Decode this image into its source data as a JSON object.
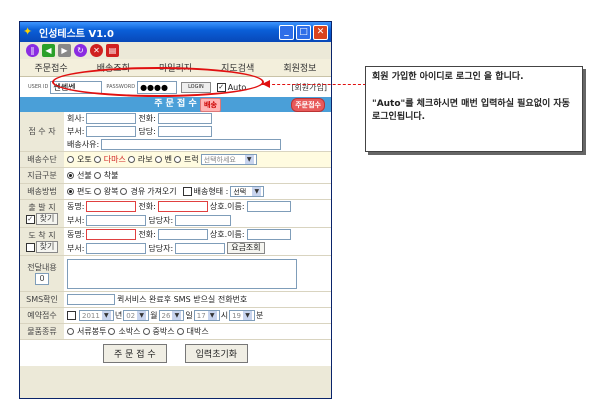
{
  "window": {
    "title": "인성테스트 V1.0"
  },
  "tabs": [
    "주문접수",
    "배송조회",
    "마일리지",
    "지도검색",
    "회원정보"
  ],
  "login": {
    "user_label": "USER ID",
    "user_value": "쎈쎈쎈",
    "pw_label": "PASSWORD",
    "pw_value": "●●●●",
    "login_btn": "LOGIN",
    "auto_label": "Auto",
    "register": "[회원가입]"
  },
  "banner": {
    "title": "주 문 접 수",
    "badge1": "배송",
    "badge2": "주문접수"
  },
  "receiver": {
    "label": "접 수 자",
    "company": "회사:",
    "phone": "전화:",
    "dept": "부서:",
    "manager": "담당:",
    "reason": "배송사유:"
  },
  "delivery_means": {
    "label": "배송수단",
    "options": [
      "오토",
      "다마스",
      "라보",
      "벤",
      "트럭"
    ],
    "select": "선택하세요"
  },
  "payment": {
    "label": "지급구분",
    "options": [
      "선불",
      "착불"
    ]
  },
  "method": {
    "label": "배송방법",
    "options": [
      "편도",
      "왕복",
      "경유",
      "가져오기"
    ],
    "type_label": "배송형태 :",
    "type_select": "선택"
  },
  "departure": {
    "label": "출 발 지",
    "find": "찾기",
    "dong": "동명:",
    "phone": "전화:",
    "shop": "상호.이름:",
    "dept": "부서:",
    "manager": "담당자:"
  },
  "arrival": {
    "label": "도 착 지",
    "find": "찾기",
    "dong": "동명:",
    "phone": "전화:",
    "shop": "상호.이름:",
    "dept": "부서:",
    "manager": "담당자:",
    "fee_btn": "요금조회"
  },
  "message": {
    "label": "전달내용",
    "count": "0"
  },
  "sms": {
    "label": "SMS확인",
    "desc": "퀵서비스 완료후 SMS 받으실 전화번호"
  },
  "reservation": {
    "label": "예약접수",
    "year": "2011",
    "year_unit": "년",
    "month": "02",
    "month_unit": "월",
    "day": "26",
    "day_unit": "일",
    "hour": "17",
    "hour_unit": "시",
    "min": "19",
    "min_unit": "분"
  },
  "goods": {
    "label": "물품종류",
    "options": [
      "서류봉투",
      "소박스",
      "중박스",
      "대박스"
    ]
  },
  "buttons": {
    "submit": "주 문 접 수",
    "reset": "입력초기화"
  },
  "callout": {
    "line1": "회원 가입한 아이디로 로그인 을 합니다.",
    "line2": "\"Auto\"를 체크하시면 매번 입력하실 필요없이 자동로그인됩니다."
  }
}
